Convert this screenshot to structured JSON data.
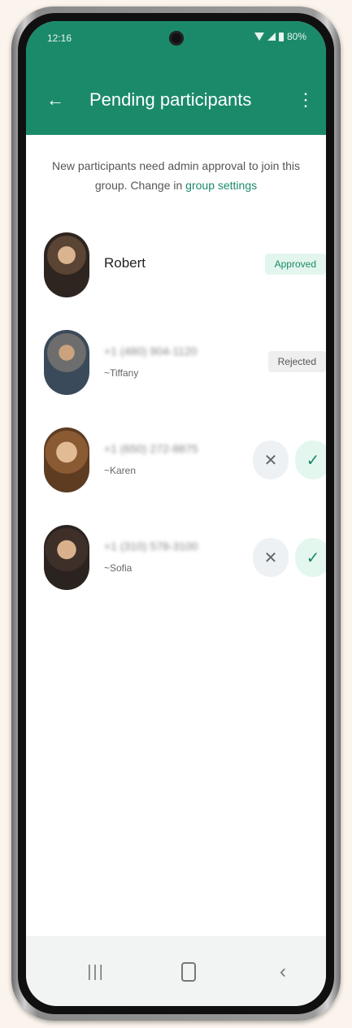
{
  "status_bar": {
    "time": "12:16",
    "battery": "80%"
  },
  "appbar": {
    "back_icon": "←",
    "title": "Pending participants",
    "more_icon": "⋮",
    "accent": "#1b8a6b"
  },
  "info": {
    "text": "New participants need admin approval to join this group. Change in ",
    "link": "group settings"
  },
  "participants": [
    {
      "name": "Robert",
      "status": "Approved"
    },
    {
      "phone": "+1 (480) 904-1120",
      "alias": "~Tiffany",
      "status": "Rejected"
    },
    {
      "phone": "+1 (650) 272-8875",
      "alias": "~Karen",
      "reject_icon": "✕",
      "approve_icon": "✓"
    },
    {
      "phone": "+1 (310) 578-3100",
      "alias": "~Sofia",
      "reject_icon": "✕",
      "approve_icon": "✓"
    }
  ],
  "navbar": {
    "recents_icon": "|||",
    "back_icon": "‹"
  }
}
